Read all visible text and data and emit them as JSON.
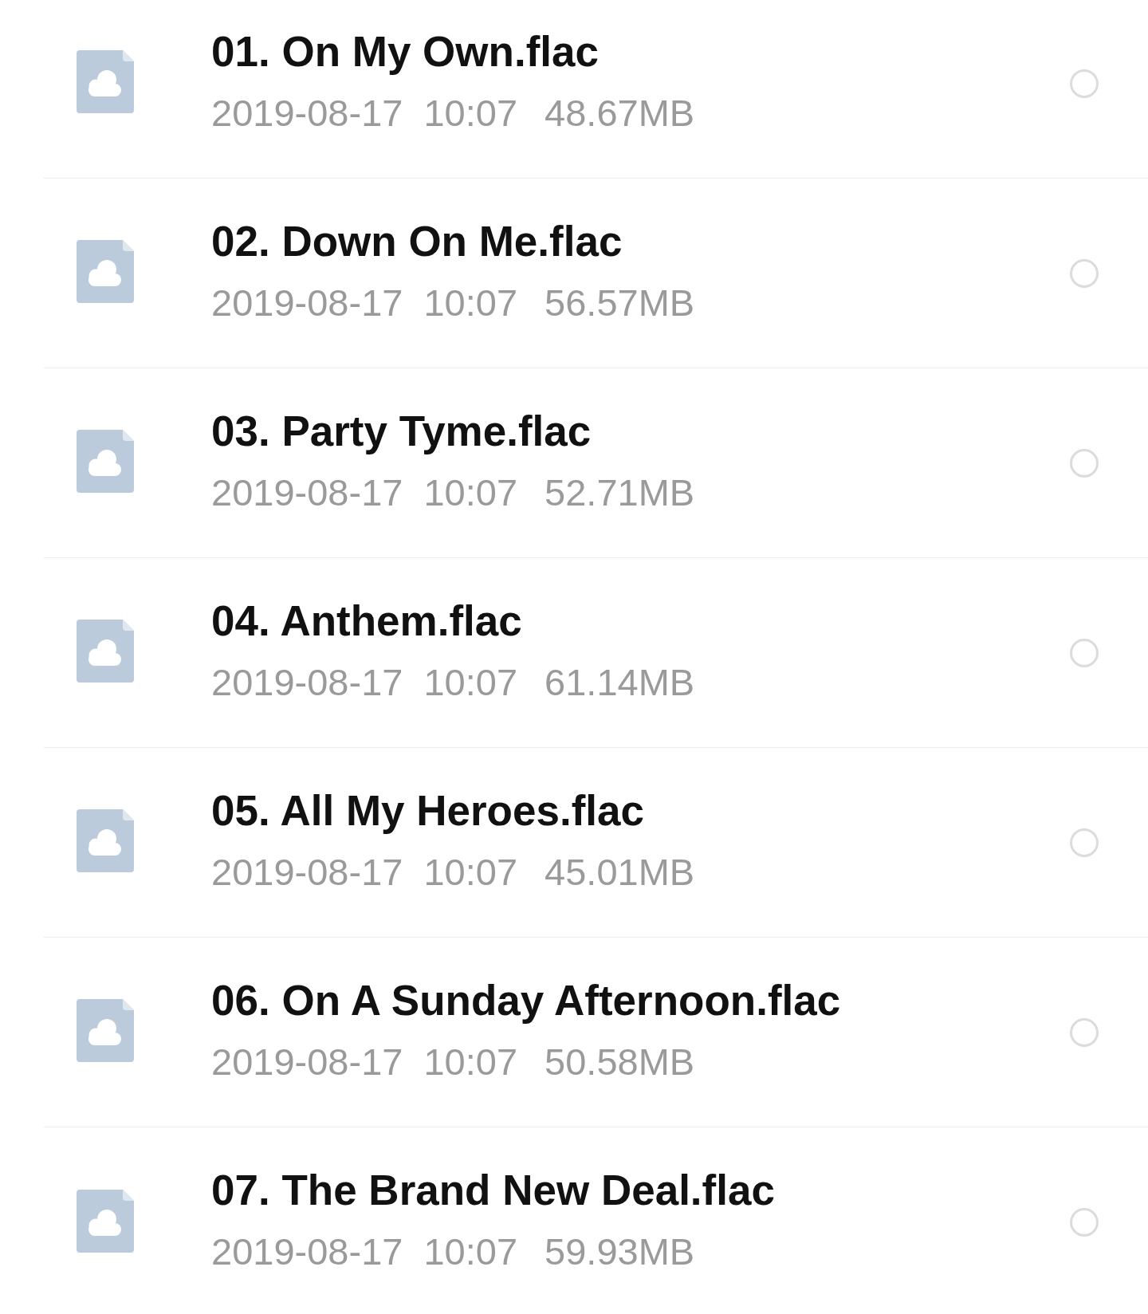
{
  "files": [
    {
      "name": "01. On My Own.flac",
      "date": "2019-08-17",
      "time": "10:07",
      "size": "48.67MB",
      "selected": false
    },
    {
      "name": "02. Down On Me.flac",
      "date": "2019-08-17",
      "time": "10:07",
      "size": "56.57MB",
      "selected": false
    },
    {
      "name": "03. Party Tyme.flac",
      "date": "2019-08-17",
      "time": "10:07",
      "size": "52.71MB",
      "selected": false
    },
    {
      "name": "04. Anthem.flac",
      "date": "2019-08-17",
      "time": "10:07",
      "size": "61.14MB",
      "selected": false
    },
    {
      "name": "05. All My Heroes.flac",
      "date": "2019-08-17",
      "time": "10:07",
      "size": "45.01MB",
      "selected": false
    },
    {
      "name": "06. On A Sunday Afternoon.flac",
      "date": "2019-08-17",
      "time": "10:07",
      "size": "50.58MB",
      "selected": false
    },
    {
      "name": "07. The Brand New Deal.flac",
      "date": "2019-08-17",
      "time": "10:07",
      "size": "59.93MB",
      "selected": false
    }
  ]
}
